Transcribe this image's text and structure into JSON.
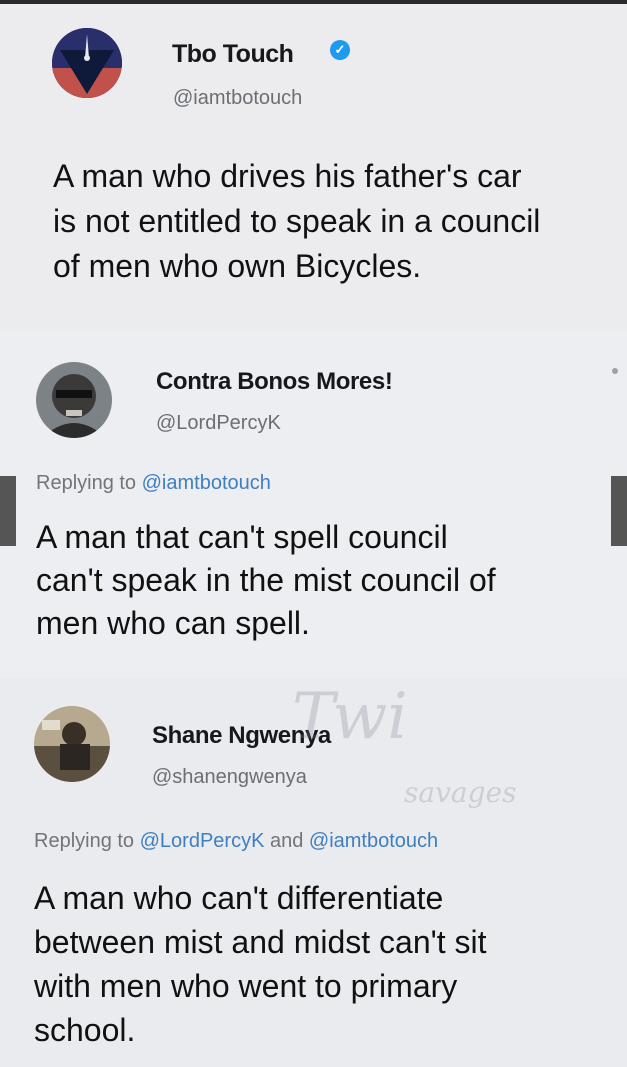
{
  "tweet": {
    "name": "Tbo Touch",
    "handle": "@iamtbotouch",
    "text_lines": [
      "A man who drives his father's car",
      "is not entitled to speak in a council",
      "of men who own Bicycles."
    ]
  },
  "reply1": {
    "name": "Contra Bonos Mores!",
    "handle": "@LordPercyK",
    "replying_prefix": "Replying to ",
    "replying_to": "@iamtbotouch",
    "text_lines": [
      "A man that can't spell council",
      "can't speak in the mist council of",
      "men who can spell."
    ]
  },
  "reply2": {
    "name": "Shane Ngwenya",
    "handle": "@shanengwenya",
    "replying_prefix": "Replying to ",
    "replying_to_1": "@LordPercyK",
    "replying_and": " and ",
    "replying_to_2": "@iamtbotouch",
    "text_lines": [
      "A man who can't differentiate",
      "between mist and midst can't sit",
      "with men who went to primary",
      "school."
    ]
  },
  "watermark": {
    "top": "Twi",
    "mid": "savages"
  },
  "colors": {
    "link": "#3f7fc0",
    "verified": "#1d9bf0",
    "background": "#ecedf0"
  },
  "icons": {
    "verified": "verified-badge-icon"
  }
}
